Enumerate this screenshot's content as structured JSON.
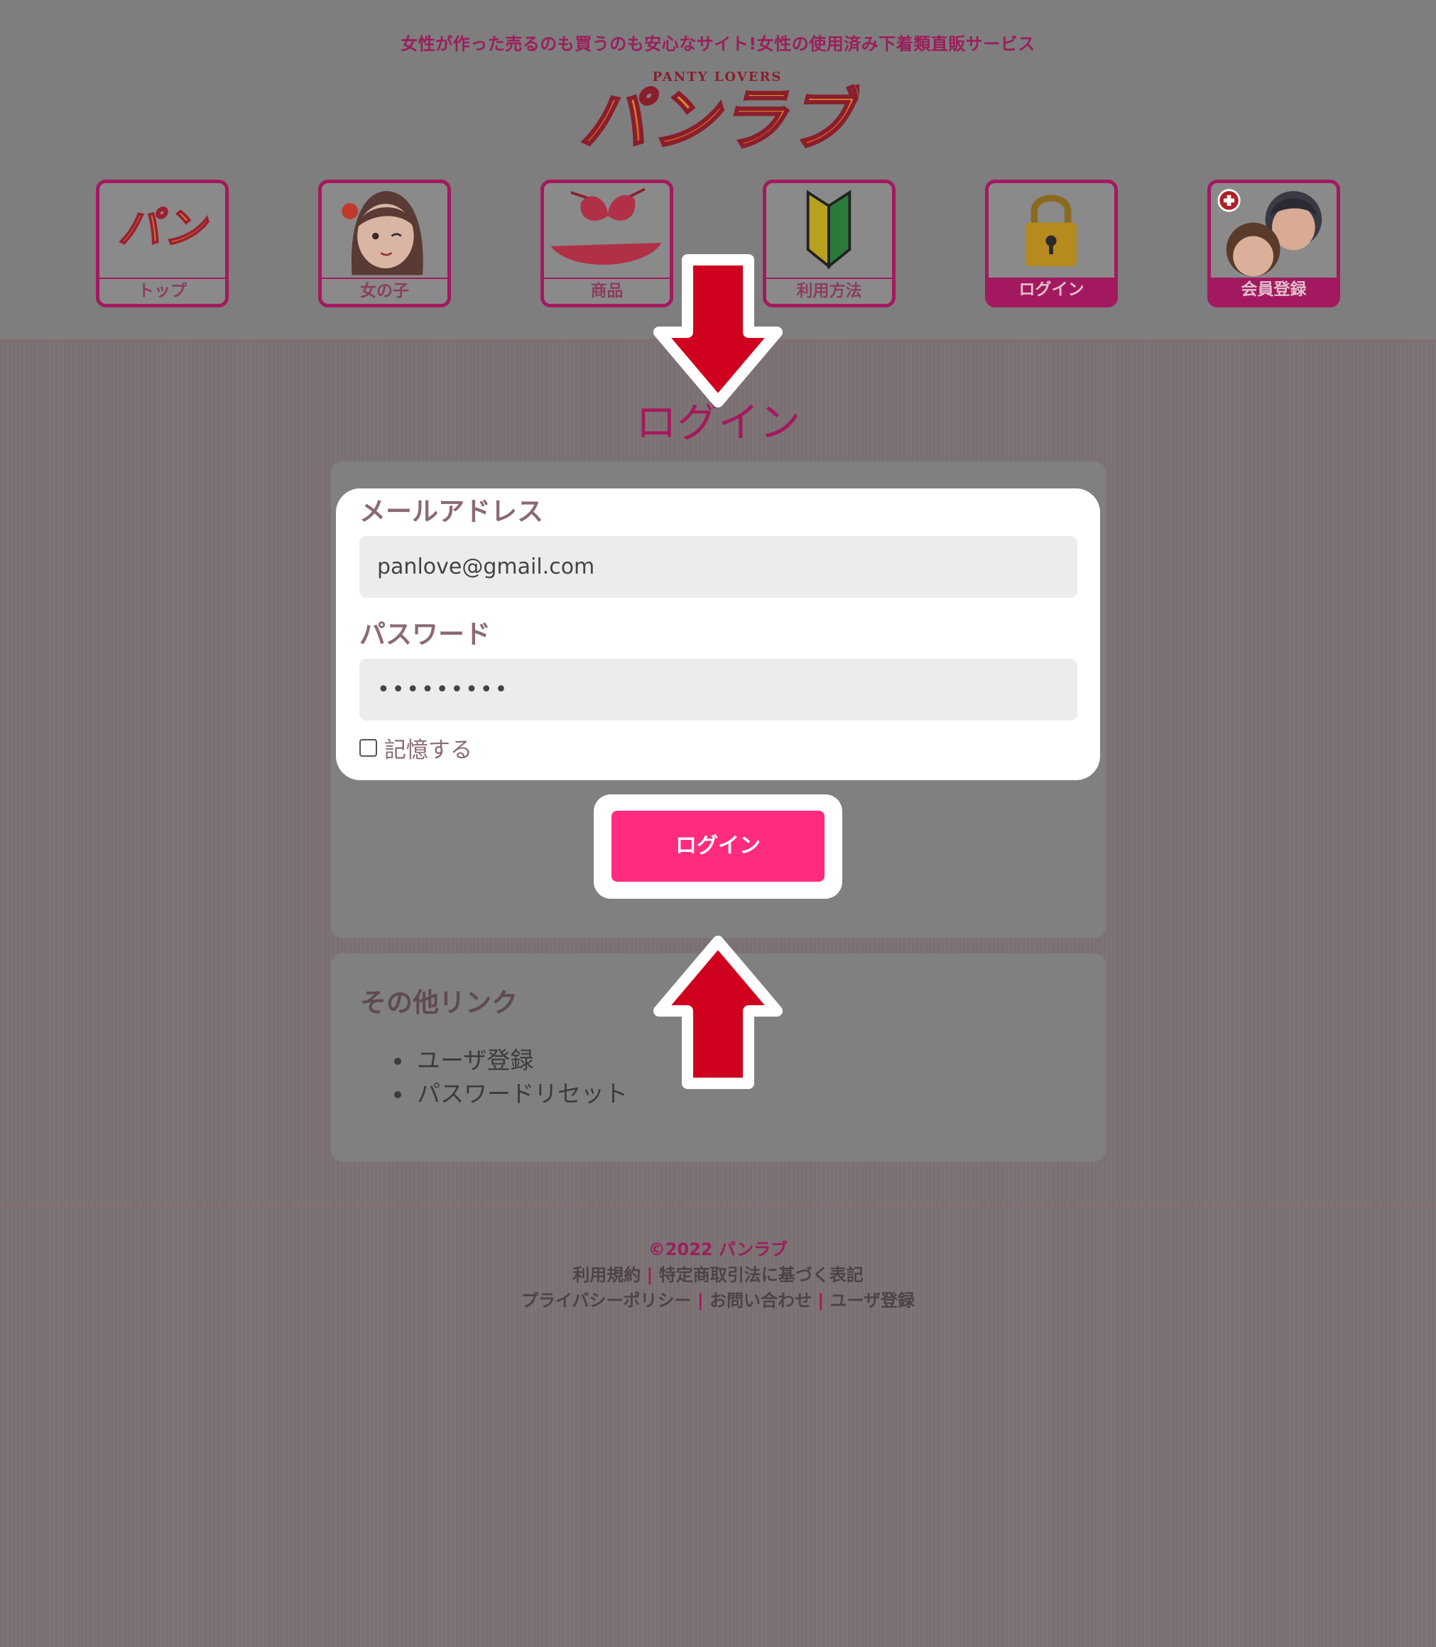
{
  "header": {
    "tagline": "女性が作った売るのも買うのも安心なサイト!女性の使用済み下着類直販サービス",
    "logo_main": "パンラブ",
    "logo_sub": "PANTY LOVERS"
  },
  "nav": {
    "items": [
      {
        "label": "トップ",
        "icon": "logo-icon"
      },
      {
        "label": "女の子",
        "icon": "girl-avatar-icon"
      },
      {
        "label": "商品",
        "icon": "bikini-icon"
      },
      {
        "label": "利用方法",
        "icon": "beginner-mark-icon"
      },
      {
        "label": "ログイン",
        "icon": "padlock-icon"
      },
      {
        "label": "会員登録",
        "icon": "couple-plus-icon"
      }
    ]
  },
  "main": {
    "title": "ログイン",
    "email_label": "メールアドレス",
    "email_value": "panlove@gmail.com",
    "password_label": "パスワード",
    "password_value": "•••••••••",
    "remember_label": "記憶する",
    "remember_checked": false,
    "login_button": "ログイン"
  },
  "links": {
    "title": "その他リンク",
    "items": [
      "ユーザ登録",
      "パスワードリセット"
    ]
  },
  "footer": {
    "copyright": "©2022 パンラブ",
    "row1": [
      "利用規約",
      "特定商取引法に基づく表記"
    ],
    "row2": [
      "プライバシーポリシー",
      "お問い合わせ",
      "ユーザ登録"
    ],
    "separator": "|"
  },
  "colors": {
    "brand": "#a3195f",
    "button": "#ff2b7e",
    "annotation_arrow": "#d0001f"
  }
}
